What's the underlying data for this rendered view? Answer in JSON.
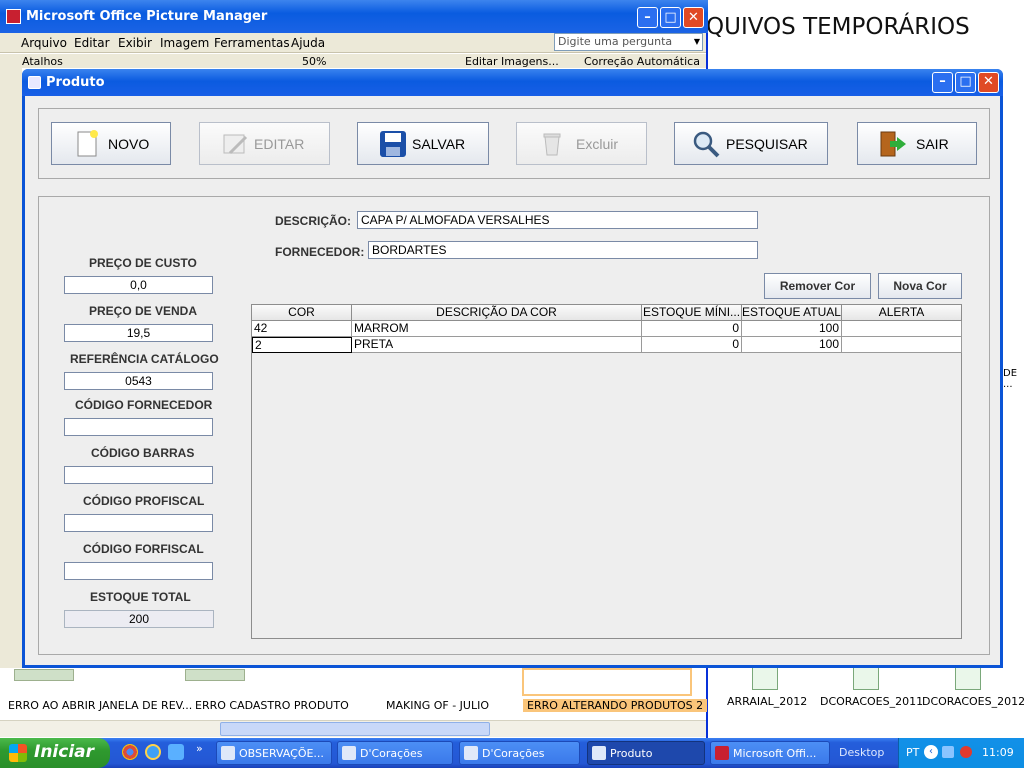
{
  "background": {
    "folder_title": "QUIVOS TEMPORÁRIOS",
    "window_title": "Microsoft Office Picture Manager",
    "menu": [
      "Arquivo",
      "Editar",
      "Exibir",
      "Imagem",
      "Ferramentas",
      "Ajuda"
    ],
    "ask_placeholder": "Digite uma pergunta",
    "toolbar_items": [
      "Atalhos",
      "50%",
      "Editar Imagens...",
      "Correção Automática"
    ],
    "thumbnails": [
      "ERRO AO ABRIR JANELA DE REV...",
      "ERRO CADASTRO PRODUTO",
      "MAKING OF -  JULIO",
      "ERRO ALTERANDO PRODUTOS 2"
    ],
    "desktop_icons": [
      "ARRAIAL_2012",
      "DCORACOES_2011",
      "DCORACOES_2012"
    ],
    "desktop_side_label": "DE ..."
  },
  "dialog": {
    "title": "Produto",
    "toolbar": {
      "novo": "NOVO",
      "editar": "EDITAR",
      "salvar": "SALVAR",
      "excluir": "Excluir",
      "pesquisar": "PESQUISAR",
      "sair": "SAIR"
    },
    "form": {
      "descricao_label": "DESCRIÇÃO:",
      "descricao_value": "CAPA P/ ALMOFADA VERSALHES",
      "fornecedor_label": "FORNECEDOR:",
      "fornecedor_value": "BORDARTES",
      "preco_custo_label": "PREÇO DE CUSTO",
      "preco_custo_value": "0,0",
      "preco_venda_label": "PREÇO DE VENDA",
      "preco_venda_value": "19,5",
      "ref_catalogo_label": "REFERÊNCIA CATÁLOGO",
      "ref_catalogo_value": "0543",
      "cod_fornecedor_label": "CÓDIGO FORNECEDOR",
      "cod_fornecedor_value": "",
      "cod_barras_label": "CÓDIGO BARRAS",
      "cod_barras_value": "",
      "cod_profiscal_label": "CÓDIGO PROFISCAL",
      "cod_profiscal_value": "",
      "cod_forfiscal_label": "CÓDIGO FORFISCAL",
      "cod_forfiscal_value": "",
      "estoque_total_label": "ESTOQUE TOTAL",
      "estoque_total_value": "200",
      "remover_cor": "Remover Cor",
      "nova_cor": "Nova Cor"
    },
    "table": {
      "columns": [
        "COR",
        "DESCRIÇÃO DA COR",
        "ESTOQUE MÍNI...",
        "ESTOQUE ATUAL",
        "ALERTA"
      ],
      "rows": [
        [
          "42",
          "MARROM",
          "0",
          "100",
          ""
        ],
        [
          "2",
          "PRETA",
          "0",
          "100",
          ""
        ]
      ]
    }
  },
  "taskbar": {
    "start": "Iniciar",
    "tasks": [
      "OBSERVAÇÕE...",
      "D'Corações",
      "D'Corações",
      "Produto",
      "Microsoft Offi..."
    ],
    "desktop": "Desktop",
    "language": "PT",
    "time": "11:09"
  }
}
